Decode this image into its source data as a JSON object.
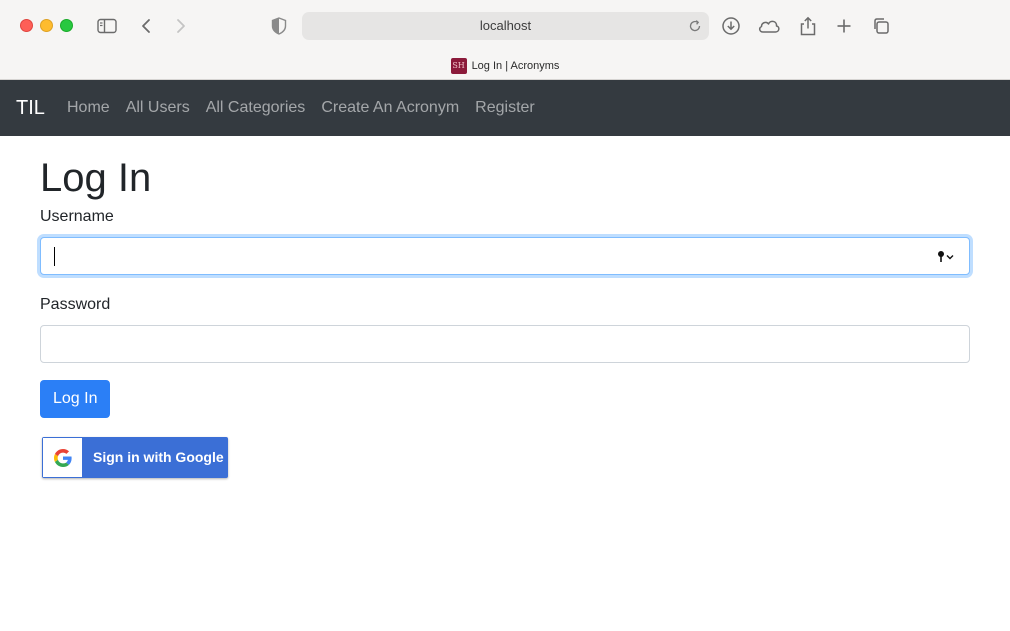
{
  "browser": {
    "url": "localhost",
    "tab_title": "Log In | Acronyms",
    "favicon_text": "SH"
  },
  "navbar": {
    "brand": "TIL",
    "links": [
      "Home",
      "All Users",
      "All Categories",
      "Create An Acronym",
      "Register"
    ]
  },
  "page": {
    "title": "Log In",
    "username_label": "Username",
    "username_value": "",
    "password_label": "Password",
    "password_value": "",
    "login_button": "Log In",
    "google_button": "Sign in with Google"
  },
  "colors": {
    "navbar_bg": "#343a40",
    "primary": "#2b7ff6",
    "google_blue": "#3b6fd6"
  }
}
